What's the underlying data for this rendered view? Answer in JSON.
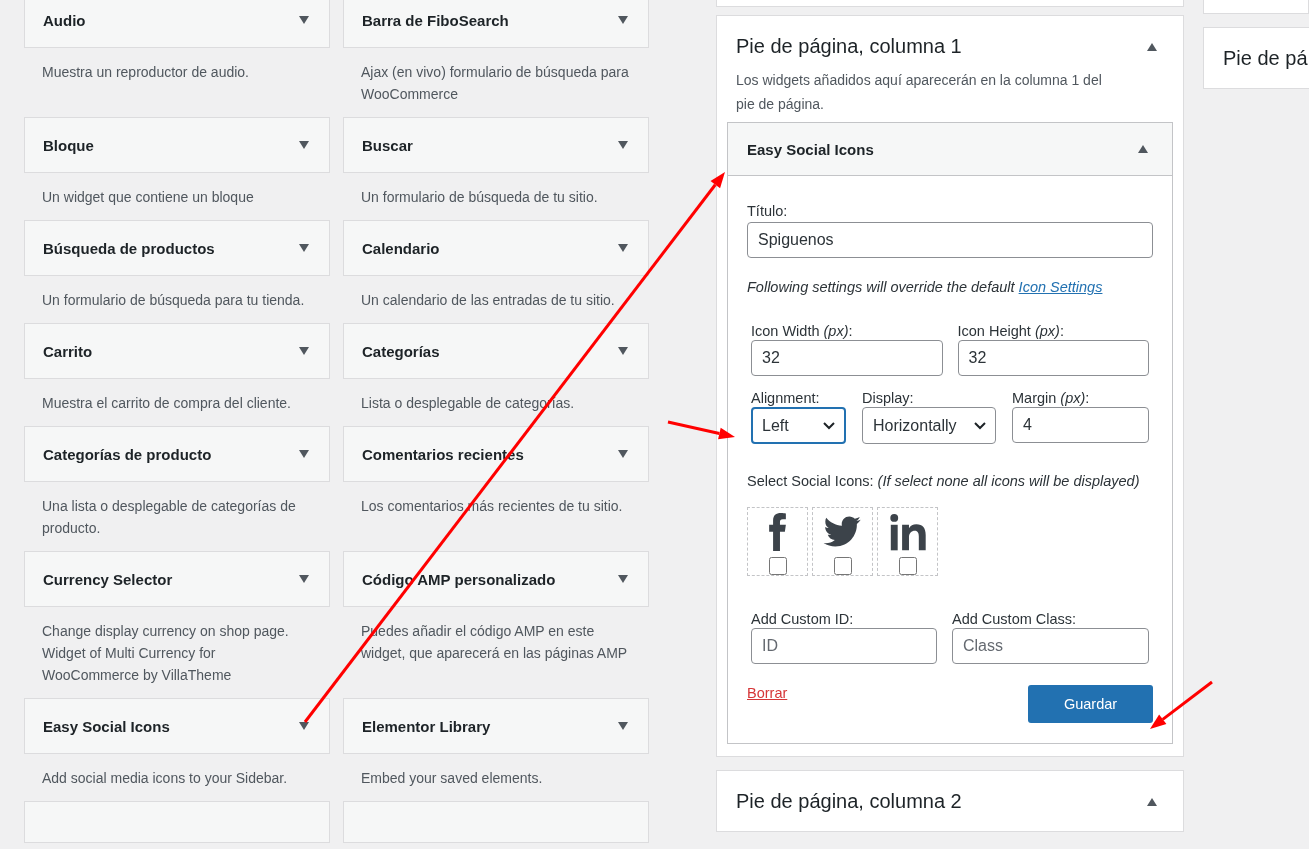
{
  "widgets": [
    {
      "kind": "full",
      "title": "Audio",
      "description": "Muestra un reproductor de audio."
    },
    {
      "kind": "full",
      "title": "Barra de FiboSearch",
      "description": "Ajax (en vivo) formulario de búsqueda para WooCommerce"
    },
    {
      "kind": "full",
      "title": "Bloque",
      "description": "Un widget que contiene un bloque"
    },
    {
      "kind": "full",
      "title": "Buscar",
      "description": "Un formulario de búsqueda de tu sitio."
    },
    {
      "kind": "full",
      "title": "Búsqueda de productos",
      "description": "Un formulario de búsqueda para tu tienda."
    },
    {
      "kind": "full",
      "title": "Calendario",
      "description": "Un calendario de las entradas de tu sitio."
    },
    {
      "kind": "full",
      "title": "Carrito",
      "description": "Muestra el carrito de compra del cliente."
    },
    {
      "kind": "full",
      "title": "Categorías",
      "description": "Lista o desplegable de categorías."
    },
    {
      "kind": "full",
      "title": "Categorías de producto",
      "description": "Una lista o desplegable de categorías de producto."
    },
    {
      "kind": "full",
      "title": "Comentarios recientes",
      "description": "Los comentarios más recientes de tu sitio."
    },
    {
      "kind": "full",
      "title": "Currency Selector",
      "description": "Change display currency on shop page. Widget of Multi Currency for WooCommerce by VillaTheme"
    },
    {
      "kind": "full",
      "title": "Código AMP personalizado",
      "description": "Puedes añadir el código AMP en este widget, que aparecerá en las páginas AMP"
    },
    {
      "kind": "full",
      "title": "Easy Social Icons",
      "description": "Add social media icons to your Sidebar."
    },
    {
      "kind": "full",
      "title": "Elementor Library",
      "description": "Embed your saved elements."
    },
    {
      "kind": "cut"
    },
    {
      "kind": "cut"
    }
  ],
  "area": {
    "title": "Pie de página, columna 1",
    "expanded": true,
    "description": "Los widgets añadidos aquí aparecerán en la columna 1 del pie de página.",
    "widget": {
      "title": "Easy Social Icons",
      "expanded": true,
      "title_label": "Título:",
      "title_value": "Spiguenos",
      "note": "Following settings will override the default",
      "note_link": "Icon Settings",
      "size_fields": [
        {
          "label": "Icon Width *(px)*:",
          "value": "32"
        },
        {
          "label": "Icon Height *(px)*:",
          "value": "32"
        }
      ],
      "alignment": {
        "label": "Alignment:",
        "value": "Left",
        "focused": true
      },
      "display": {
        "label": "Display:",
        "value": "Horizontally",
        "focused": false
      },
      "margin": {
        "label": "Margin *(px)*:",
        "value": "4"
      },
      "social_label": "Select Social Icons: *(If select none all icons will be displayed)*",
      "social_icons": [
        {
          "kind": "facebook",
          "checked": false
        },
        {
          "kind": "twitter",
          "checked": false
        },
        {
          "kind": "linkedin",
          "checked": false
        }
      ],
      "custom_fields": [
        {
          "label": "Add Custom ID:",
          "placeholder": "ID"
        },
        {
          "label": "Add Custom Class:",
          "placeholder": "Class"
        }
      ],
      "delete_link": "Borrar",
      "save_button": "Guardar"
    }
  },
  "next_area": {
    "title": "Pie de página, columna 2",
    "expanded": true
  },
  "side_area": {
    "title": "Pie de pá"
  }
}
